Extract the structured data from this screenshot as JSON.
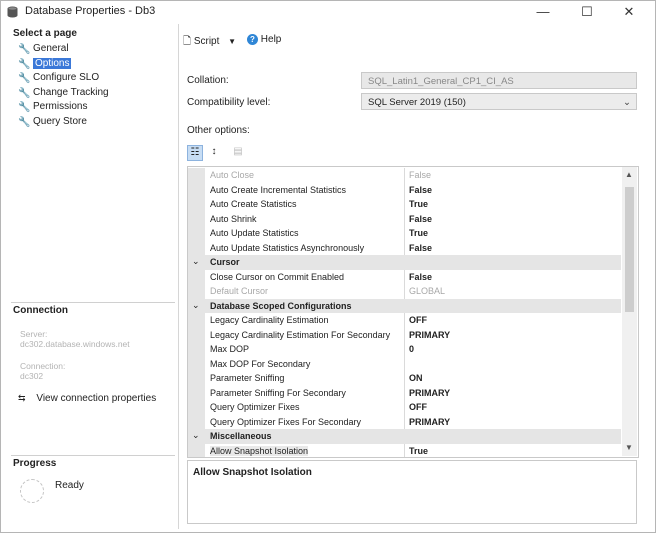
{
  "window": {
    "title": "Database Properties - Db3",
    "min_glyph": "—",
    "max_glyph": "☐",
    "close_glyph": "✕"
  },
  "sidebar": {
    "select_page_heading": "Select a page",
    "pages": [
      {
        "label": "General",
        "selected": false
      },
      {
        "label": "Options",
        "selected": true
      },
      {
        "label": "Configure SLO",
        "selected": false
      },
      {
        "label": "Change Tracking",
        "selected": false
      },
      {
        "label": "Permissions",
        "selected": false
      },
      {
        "label": "Query Store",
        "selected": false
      }
    ],
    "connection_heading": "Connection",
    "server_label": "Server:",
    "server_value": "dc302.database.windows.net",
    "connection_label": "Connection:",
    "connection_value": "dc302",
    "view_connection_label": "View connection properties",
    "progress_heading": "Progress",
    "progress_status": "Ready"
  },
  "toolbar": {
    "script_label": "Script",
    "help_label": "Help"
  },
  "form": {
    "collation_label": "Collation:",
    "collation_value": "SQL_Latin1_General_CP1_CI_AS",
    "compat_label": "Compatibility level:",
    "compat_value": "SQL Server 2019 (150)",
    "other_options_label": "Other options:"
  },
  "grid": {
    "rows": [
      {
        "type": "prop",
        "name": "Auto Close",
        "value": "False",
        "dim": true
      },
      {
        "type": "prop",
        "name": "Auto Create Incremental Statistics",
        "value": "False"
      },
      {
        "type": "prop",
        "name": "Auto Create Statistics",
        "value": "True"
      },
      {
        "type": "prop",
        "name": "Auto Shrink",
        "value": "False"
      },
      {
        "type": "prop",
        "name": "Auto Update Statistics",
        "value": "True"
      },
      {
        "type": "prop",
        "name": "Auto Update Statistics Asynchronously",
        "value": "False"
      },
      {
        "type": "cat",
        "name": "Cursor"
      },
      {
        "type": "prop",
        "name": "Close Cursor on Commit Enabled",
        "value": "False"
      },
      {
        "type": "prop",
        "name": "Default Cursor",
        "value": "GLOBAL",
        "dim": true
      },
      {
        "type": "cat",
        "name": "Database Scoped Configurations"
      },
      {
        "type": "prop",
        "name": "Legacy Cardinality Estimation",
        "value": "OFF"
      },
      {
        "type": "prop",
        "name": "Legacy Cardinality Estimation For Secondary",
        "value": "PRIMARY"
      },
      {
        "type": "prop",
        "name": "Max DOP",
        "value": "0"
      },
      {
        "type": "prop",
        "name": "Max DOP For Secondary",
        "value": ""
      },
      {
        "type": "prop",
        "name": "Parameter Sniffing",
        "value": "ON"
      },
      {
        "type": "prop",
        "name": "Parameter Sniffing For Secondary",
        "value": "PRIMARY"
      },
      {
        "type": "prop",
        "name": "Query Optimizer Fixes",
        "value": "OFF"
      },
      {
        "type": "prop",
        "name": "Query Optimizer Fixes For Secondary",
        "value": "PRIMARY"
      },
      {
        "type": "cat",
        "name": "Miscellaneous"
      },
      {
        "type": "prop",
        "name": "Allow Snapshot Isolation",
        "value": "True",
        "selected": true
      }
    ]
  },
  "description": {
    "title": "Allow Snapshot Isolation"
  },
  "colors": {
    "selection": "#3b78d8",
    "category_bg": "#e5e5e5"
  }
}
